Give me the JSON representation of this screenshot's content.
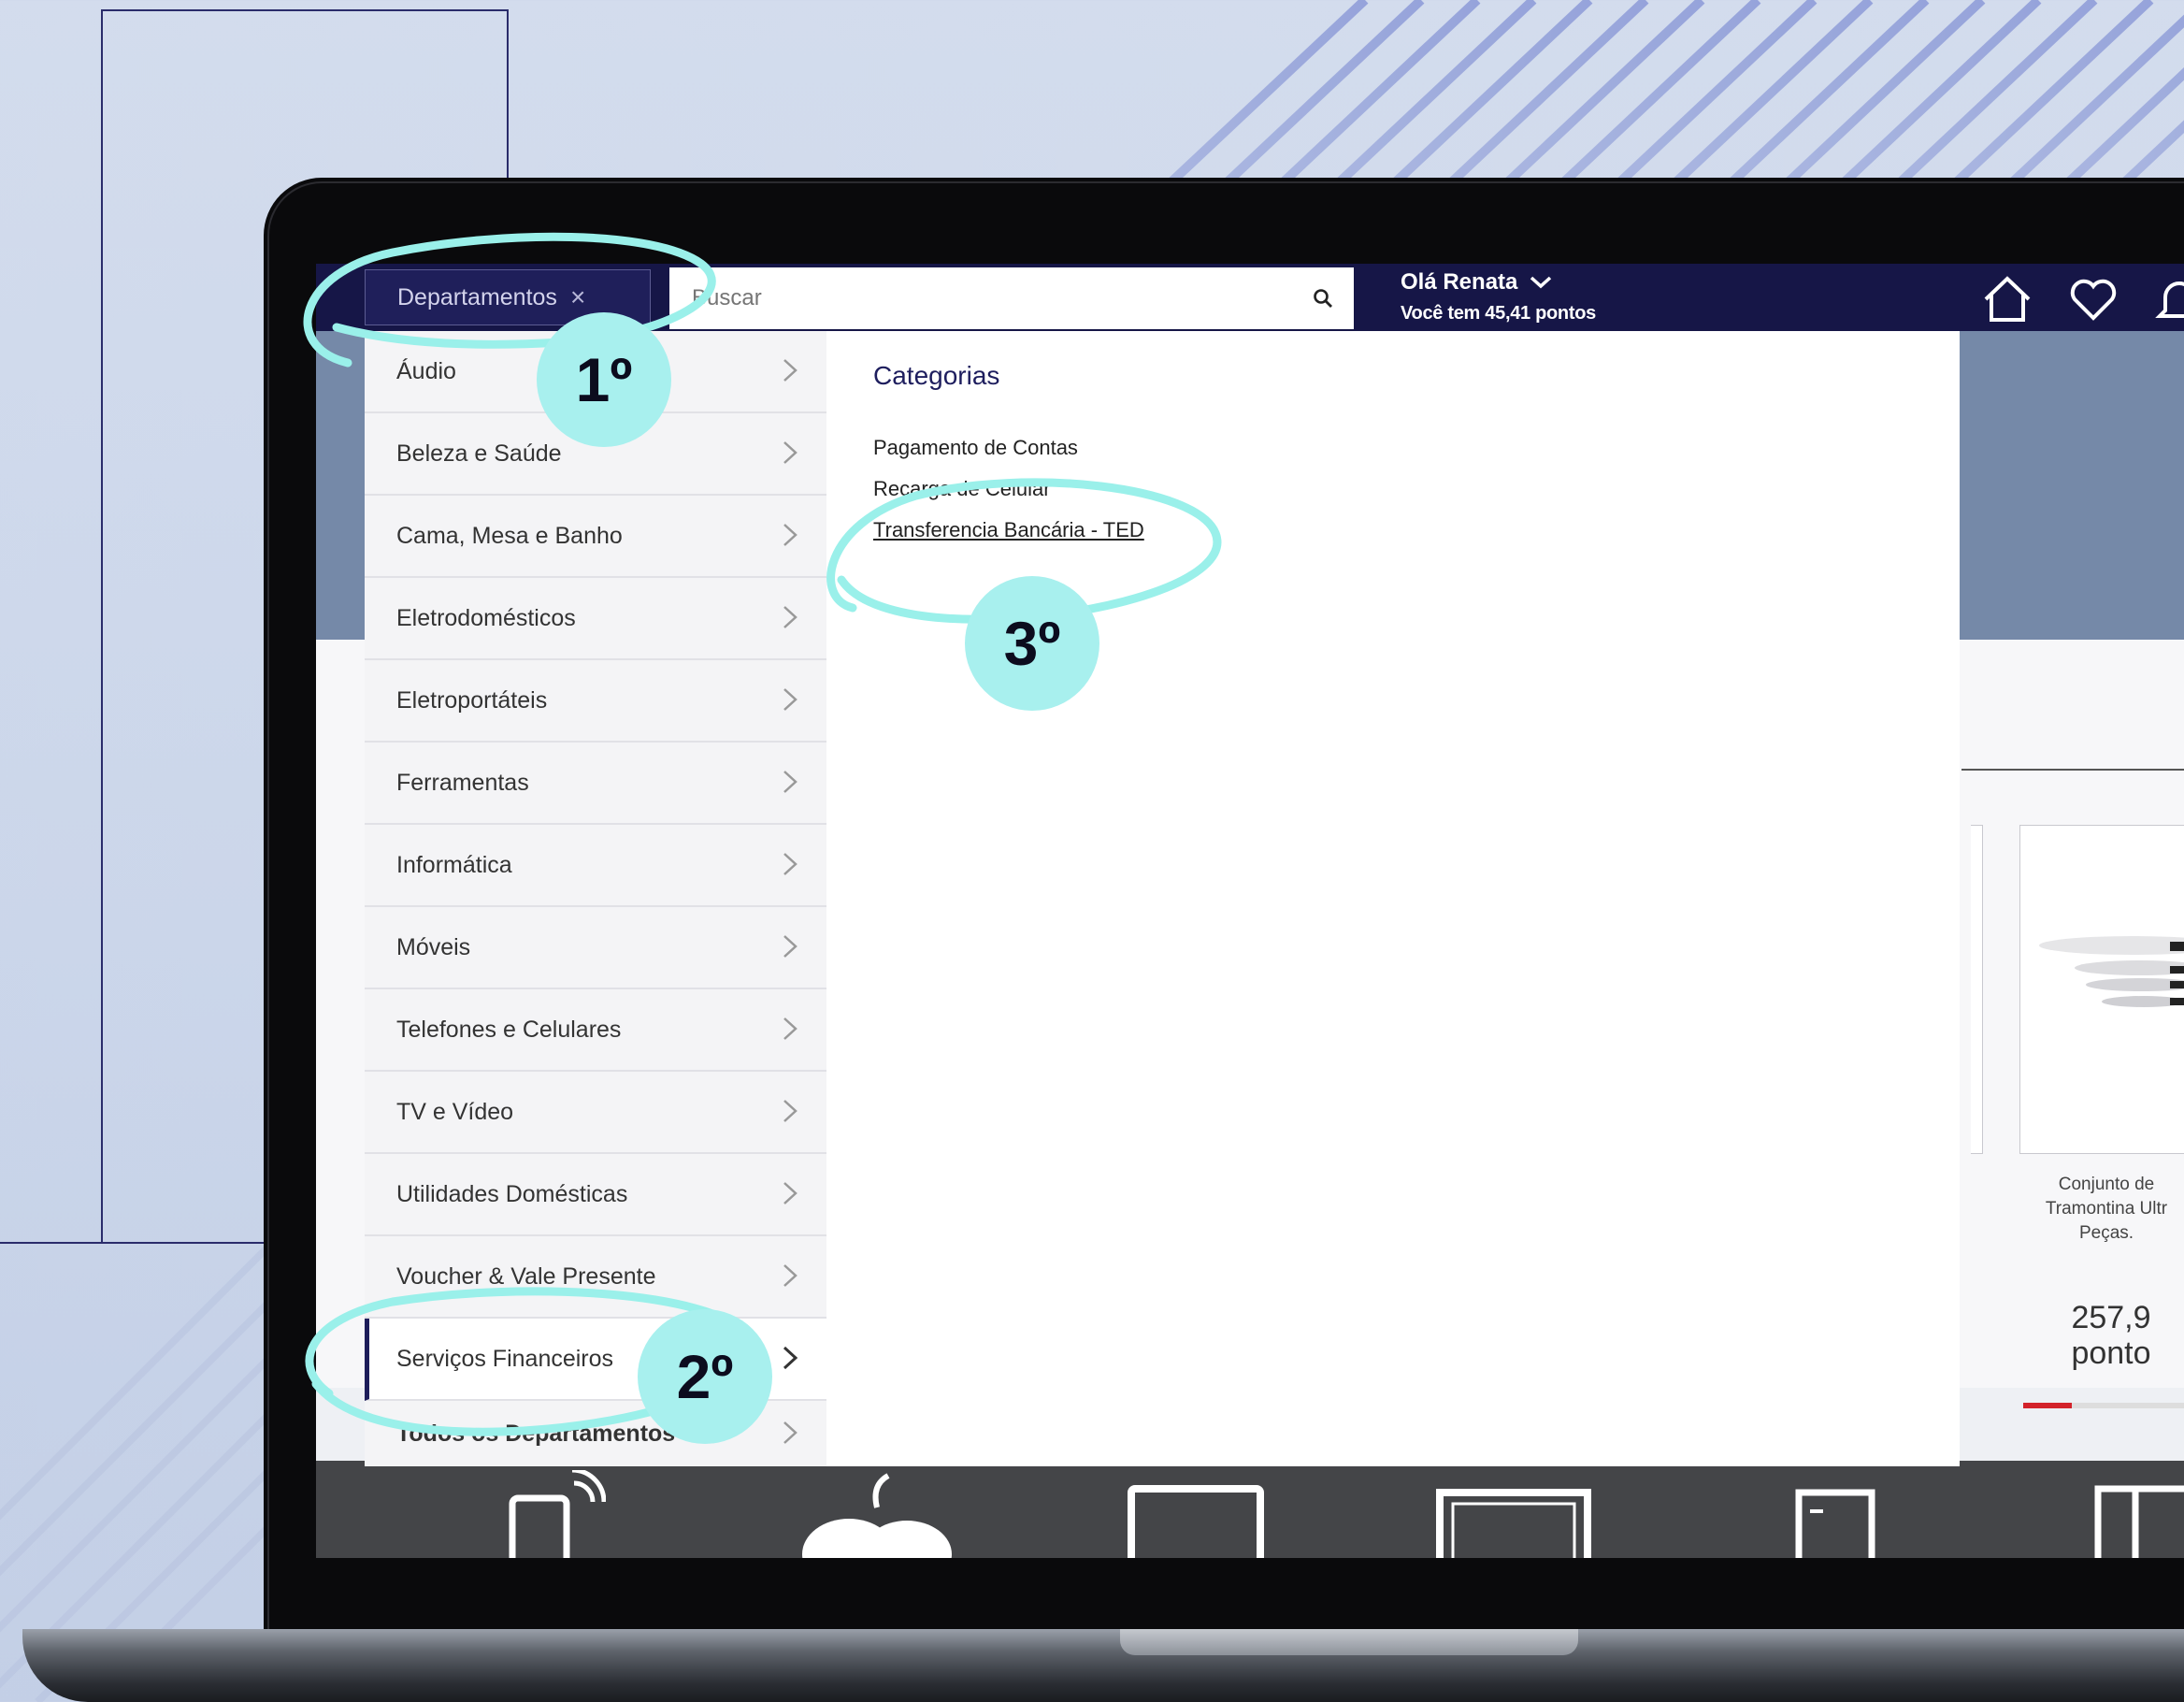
{
  "header": {
    "departments_label": "Departamentos",
    "close_symbol": "×",
    "search_placeholder": "Buscar",
    "greeting": "Olá Renata",
    "points_text": "Você tem 45,41 pontos"
  },
  "menu": {
    "items": [
      {
        "label": "Áudio"
      },
      {
        "label": "Beleza e Saúde"
      },
      {
        "label": "Cama, Mesa e Banho"
      },
      {
        "label": "Eletrodomésticos"
      },
      {
        "label": "Eletroportáteis"
      },
      {
        "label": "Ferramentas"
      },
      {
        "label": "Informática"
      },
      {
        "label": "Móveis"
      },
      {
        "label": "Telefones e Celulares"
      },
      {
        "label": "TV e Vídeo"
      },
      {
        "label": "Utilidades Domésticas"
      },
      {
        "label": "Voucher & Vale Presente"
      },
      {
        "label": "Serviços Financeiros"
      },
      {
        "label": "Todos os Departamentos"
      }
    ]
  },
  "panel": {
    "heading": "Categorias",
    "links": [
      "Pagamento de Contas",
      "Recarga de Celular",
      "Transferencia Bancária - TED"
    ]
  },
  "product": {
    "name_lines": [
      "Conjunto de",
      "Tramontina Ultr",
      "Peças."
    ],
    "price": "257,9",
    "unit": "ponto"
  },
  "steps": [
    "1º",
    "2º",
    "3º"
  ],
  "colors": {
    "navy": "#161647",
    "highlight": "#a8f0ee",
    "progress": "#d3222a"
  }
}
